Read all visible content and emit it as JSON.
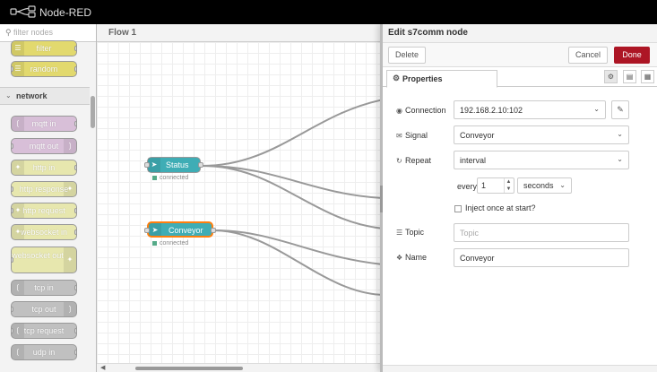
{
  "app": {
    "title": "Node-RED"
  },
  "palette": {
    "search_placeholder": "filter nodes",
    "top_nodes": [
      {
        "label": "filter",
        "color": "#e2d96e"
      },
      {
        "label": "random",
        "color": "#e2d96e"
      }
    ],
    "category": {
      "label": "network"
    },
    "network_nodes": [
      {
        "label": "mqtt in",
        "color": "#d8bfd8"
      },
      {
        "label": "mqtt out",
        "color": "#d8bfd8"
      },
      {
        "label": "http in",
        "color": "#e7e7ae"
      },
      {
        "label": "http response",
        "color": "#e7e7ae"
      },
      {
        "label": "http request",
        "color": "#e7e7ae"
      },
      {
        "label": "websocket in",
        "color": "#e7e7ae"
      },
      {
        "label": "websocket out",
        "color": "#e7e7ae"
      },
      {
        "label": "tcp in",
        "color": "#c0c0c0"
      },
      {
        "label": "tcp out",
        "color": "#c0c0c0"
      },
      {
        "label": "tcp request",
        "color": "#c0c0c0"
      },
      {
        "label": "udp in",
        "color": "#c0c0c0"
      }
    ]
  },
  "workspace": {
    "tab_label": "Flow 1",
    "nodes": [
      {
        "label": "Status",
        "status": "connected"
      },
      {
        "label": "Conveyor",
        "status": "connected"
      }
    ]
  },
  "tray": {
    "title": "Edit s7comm node",
    "delete_label": "Delete",
    "cancel_label": "Cancel",
    "done_label": "Done",
    "tab_label": "Properties",
    "fields": {
      "connection": {
        "label": "Connection",
        "value": "192.168.2.10:102"
      },
      "signal": {
        "label": "Signal",
        "value": "Conveyor"
      },
      "repeat": {
        "label": "Repeat",
        "value": "interval"
      },
      "every": {
        "label": "every",
        "value": "1",
        "unit": "seconds"
      },
      "inject_once": {
        "label": "Inject once at start?"
      },
      "topic": {
        "label": "Topic",
        "placeholder": "Topic"
      },
      "name": {
        "label": "Name",
        "value": "Conveyor"
      }
    }
  },
  "colors": {
    "header": "#000000",
    "accent": "#ad1625",
    "node": "#3fadb5",
    "selected": "#ff7f0e"
  }
}
